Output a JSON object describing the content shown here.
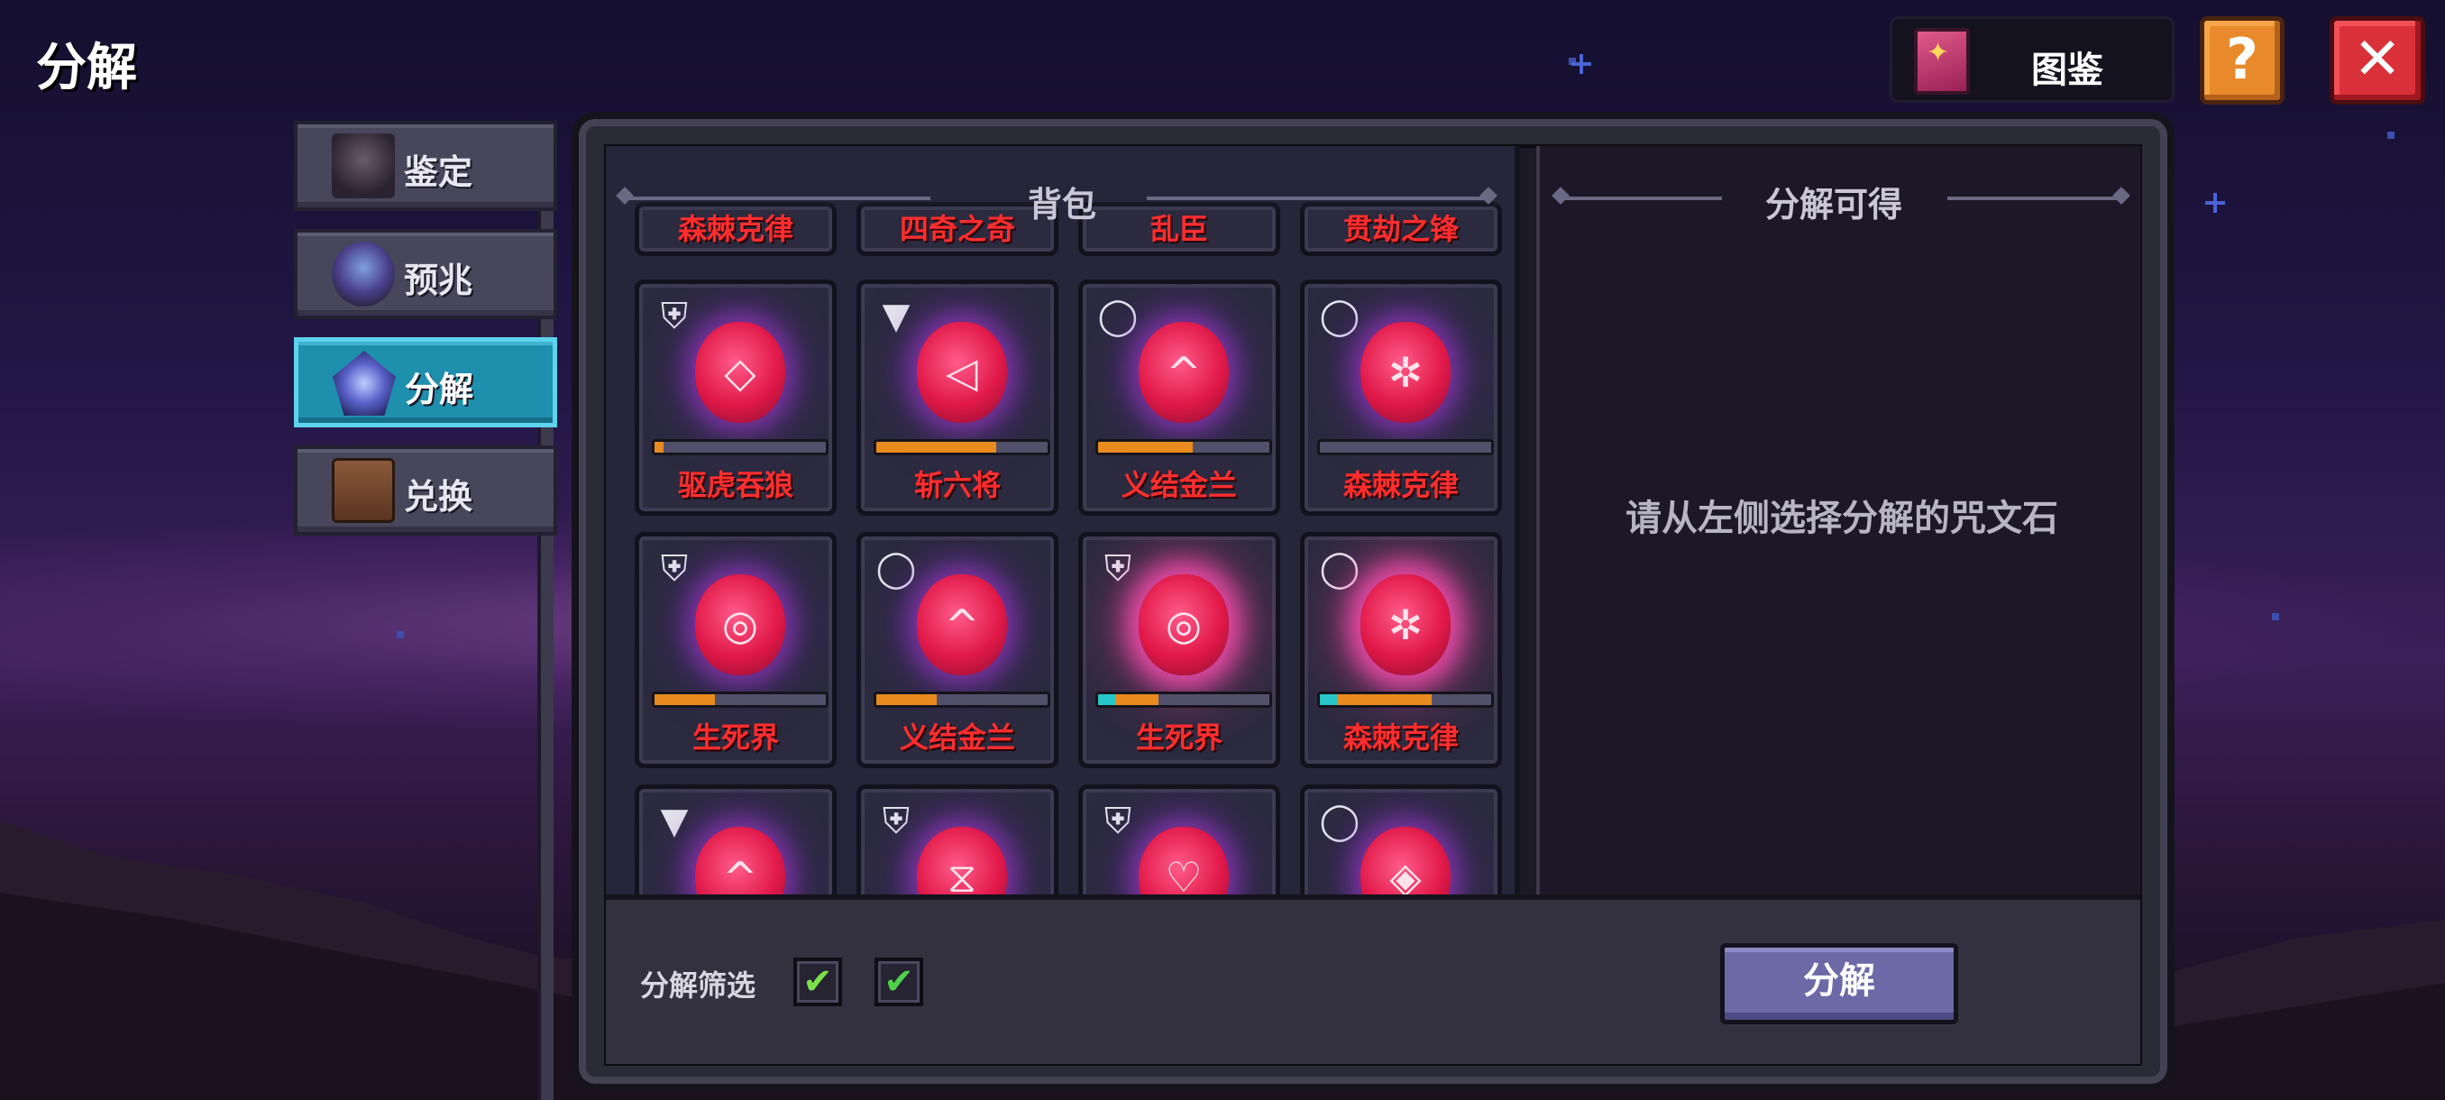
{
  "page": {
    "title": "分解"
  },
  "topbar": {
    "codex_label": "图鉴",
    "help_label": "?",
    "close_label": "✕"
  },
  "tabs": [
    {
      "label": "鉴定",
      "icon": "anvil-icon",
      "active": false
    },
    {
      "label": "预兆",
      "icon": "crystal-ball-icon",
      "active": false
    },
    {
      "label": "分解",
      "icon": "rune-gem-icon",
      "active": true
    },
    {
      "label": "兑换",
      "icon": "chest-icon",
      "active": false
    }
  ],
  "bag": {
    "header": "背包",
    "top_row": [
      "森棘克律",
      "四奇之奇",
      "乱臣",
      "贯劫之锋"
    ],
    "items": [
      {
        "name": "驱虎吞狼",
        "slot_icon": "armor-icon",
        "glyph": "◇",
        "progress_orange": 0.05,
        "progress_cyan": 0.0
      },
      {
        "name": "斩六将",
        "slot_icon": "hat-icon",
        "glyph": "◁",
        "progress_orange": 0.7,
        "progress_cyan": 0.0
      },
      {
        "name": "义结金兰",
        "slot_icon": "necklace-icon",
        "glyph": "^",
        "progress_orange": 0.55,
        "progress_cyan": 0.0
      },
      {
        "name": "森棘克律",
        "slot_icon": "necklace-icon",
        "glyph": "✲",
        "progress_orange": 0.0,
        "progress_cyan": 0.0
      },
      {
        "name": "生死界",
        "slot_icon": "armor-icon",
        "glyph": "◎",
        "progress_orange": 0.35,
        "progress_cyan": 0.0
      },
      {
        "name": "义结金兰",
        "slot_icon": "necklace-icon",
        "glyph": "^",
        "progress_orange": 0.35,
        "progress_cyan": 0.0
      },
      {
        "name": "生死界",
        "slot_icon": "armor-icon",
        "glyph": "◎",
        "progress_orange": 0.35,
        "progress_cyan": 0.1
      },
      {
        "name": "森棘克律",
        "slot_icon": "necklace-icon",
        "glyph": "✲",
        "progress_orange": 0.65,
        "progress_cyan": 0.1
      },
      {
        "name": "",
        "slot_icon": "hat-icon",
        "glyph": "^",
        "progress_orange": 0.0,
        "progress_cyan": 0.0
      },
      {
        "name": "",
        "slot_icon": "armor-icon",
        "glyph": "⧖",
        "progress_orange": 0.0,
        "progress_cyan": 0.0
      },
      {
        "name": "",
        "slot_icon": "armor-icon",
        "glyph": "♡",
        "progress_orange": 0.0,
        "progress_cyan": 0.0
      },
      {
        "name": "",
        "slot_icon": "necklace-icon",
        "glyph": "◈",
        "progress_orange": 0.0,
        "progress_cyan": 0.0
      }
    ]
  },
  "result": {
    "header": "分解可得",
    "message": "请从左侧选择分解的咒文石"
  },
  "bottom": {
    "filter_label": "分解筛选",
    "checkbox1": "✔",
    "checkbox2": "✔",
    "decompose_label": "分解"
  },
  "colors": {
    "rune_red": "#e01848",
    "name_red": "#ff2e2e",
    "active_tab": "#1f8fae",
    "progress_orange": "#e88a1e",
    "progress_cyan": "#27c7c9"
  }
}
